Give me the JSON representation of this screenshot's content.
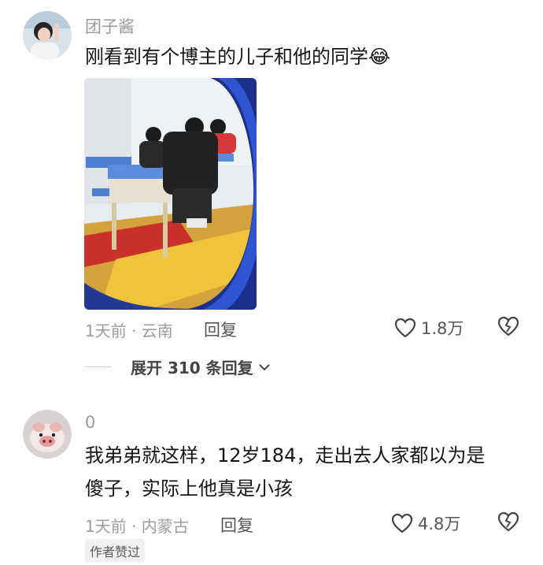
{
  "comments": [
    {
      "username": "团子酱",
      "text": "刚看到有个博主的儿子和他的同学😂",
      "time_location": "1天前 · 云南",
      "reply_label": "回复",
      "likes": "1.8万",
      "expand_label": "展开 310 条回复"
    },
    {
      "username": "0",
      "text_line1": "我弟弟就这样，12岁184，走出去人家都以为是",
      "text_line2": "傻子，实际上他真是小孩",
      "time_location": "1天前 · 内蒙古",
      "reply_label": "回复",
      "likes": "4.8万",
      "badge": "作者赞过"
    }
  ],
  "icons": {
    "like": "heart-outline-icon",
    "dislike": "broken-heart-icon",
    "chevron": "chevron-down-icon"
  }
}
